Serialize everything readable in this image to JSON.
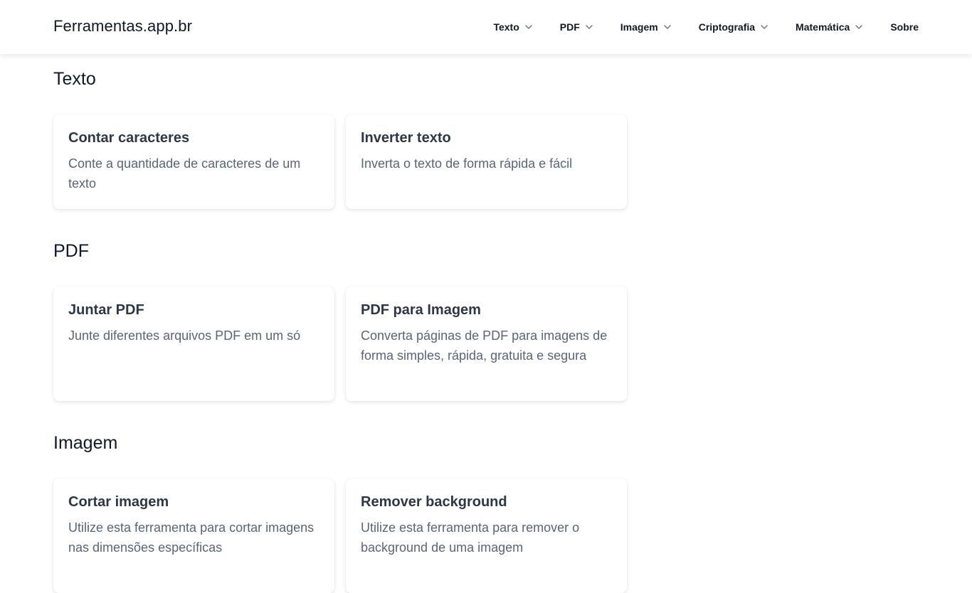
{
  "header": {
    "brand": "Ferramentas.app.br",
    "nav": [
      {
        "label": "Texto",
        "has_dropdown": true,
        "icon": "chevron-down-icon"
      },
      {
        "label": "PDF",
        "has_dropdown": true,
        "icon": "chevron-down-icon"
      },
      {
        "label": "Imagem",
        "has_dropdown": true,
        "icon": "chevron-down-icon"
      },
      {
        "label": "Criptografia",
        "has_dropdown": true,
        "icon": "chevron-down-icon"
      },
      {
        "label": "Matemática",
        "has_dropdown": true,
        "icon": "chevron-down-icon"
      },
      {
        "label": "Sobre",
        "has_dropdown": false
      }
    ]
  },
  "sections": [
    {
      "title": "Texto",
      "cards": [
        {
          "title": "Contar caracteres",
          "description": "Conte a quantidade de caracteres de um texto"
        },
        {
          "title": "Inverter texto",
          "description": "Inverta o texto de forma rápida e fácil"
        }
      ]
    },
    {
      "title": "PDF",
      "cards": [
        {
          "title": "Juntar PDF",
          "description": "Junte diferentes arquivos PDF em um só"
        },
        {
          "title": "PDF para Imagem",
          "description": "Converta páginas de PDF para imagens de forma simples, rápida, gratuita e segura"
        }
      ]
    },
    {
      "title": "Imagem",
      "cards": [
        {
          "title": "Cortar imagem",
          "description": "Utilize esta ferramenta para cortar imagens nas dimensões específicas"
        },
        {
          "title": "Remover background",
          "description": "Utilize esta ferramenta para remover o background de uma imagem"
        }
      ]
    }
  ],
  "colors": {
    "text_primary": "#111827",
    "card_title": "#2d3748",
    "card_description": "#5a6578",
    "background": "#ffffff"
  }
}
